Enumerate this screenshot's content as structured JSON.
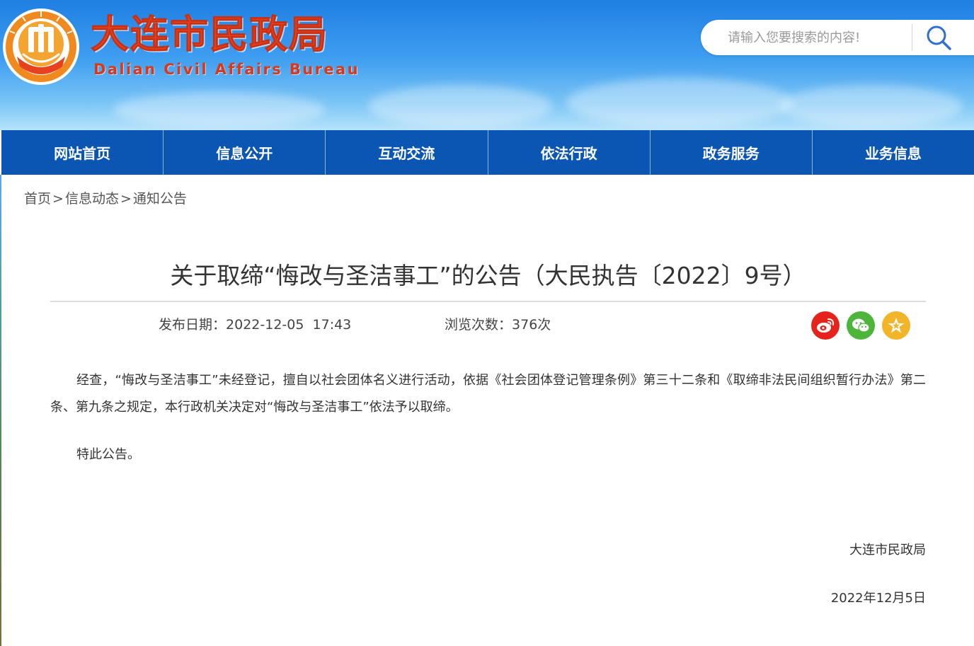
{
  "header": {
    "site_name_cn": "大连市民政局",
    "site_name_en": "Dalian Civil Affairs Bureau",
    "search_placeholder": "请输入您要搜索的内容!"
  },
  "nav": {
    "items": [
      {
        "label": "网站首页"
      },
      {
        "label": "信息公开"
      },
      {
        "label": "互动交流"
      },
      {
        "label": "依法行政"
      },
      {
        "label": "政务服务"
      },
      {
        "label": "业务信息"
      }
    ]
  },
  "breadcrumb": {
    "items": [
      "首页",
      "信息动态",
      "通知公告"
    ],
    "separator": ">"
  },
  "article": {
    "title": "关于取缔“悔改与圣洁事工”的公告（大民执告〔2022〕9号）",
    "publish_label": "发布日期：",
    "publish_date": "2022-12-05  17:43",
    "views_label": "浏览次数：",
    "views_count": "376次",
    "paragraph_1": "经查，“悔改与圣洁事工”未经登记，擅自以社会团体名义进行活动，依据《社会团体登记管理条例》第三十二条和《取缔非法民间组织暂行办法》第二条、第九条之规定，本行政机关决定对“悔改与圣洁事工”依法予以取缔。",
    "paragraph_2": "特此公告。",
    "signature_org": "大连市民政局",
    "signature_date": "2022年12月5日"
  },
  "share": {
    "icons": [
      "weibo-icon",
      "wechat-icon",
      "favorite-star-icon"
    ],
    "colors": {
      "weibo": "#e5221c",
      "wechat": "#4db53a",
      "favorite": "#f2b52a"
    }
  },
  "theme": {
    "nav_bg": "#0b55b3",
    "brand_red": "#e8411f",
    "header_blue": "#1f7fe3"
  }
}
